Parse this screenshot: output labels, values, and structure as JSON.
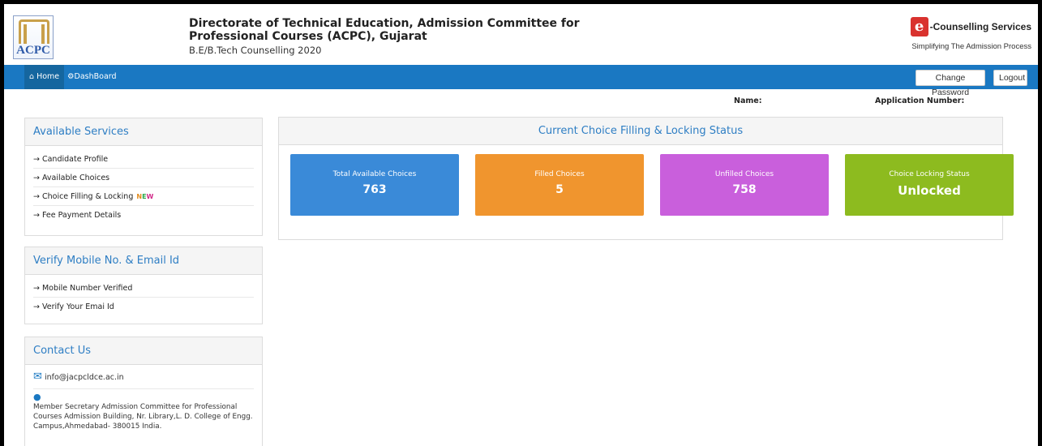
{
  "header": {
    "logo_text": "ACPC",
    "title_line1": "Directorate of Technical Education, Admission Committee for",
    "title_line2": "Professional Courses (ACPC), Gujarat",
    "subtitle": "B.E/B.Tech Counselling 2020",
    "ec_mark": "e",
    "ec_name": "-Counselling Services",
    "ec_tagline": "Simplifying The Admission Process"
  },
  "nav": {
    "home_icon": "home-icon",
    "home": "Home",
    "dashboard_icon": "dashboard-icon",
    "dashboard": "DashBoard",
    "change_password": "Change Password",
    "logout": "Logout"
  },
  "info": {
    "name_label": "Name:",
    "application_label": "Application Number:"
  },
  "available_services": {
    "title": "Available Services",
    "items": [
      "→ Candidate Profile",
      "→ Available Choices",
      "→ Choice Filling & Locking",
      "→ Fee Payment Details"
    ],
    "new_badge": [
      "N",
      "E",
      "W"
    ]
  },
  "verify": {
    "title": "Verify Mobile No. & Email Id",
    "items": [
      "→ Mobile Number Verified",
      "→ Verify Your Emai Id"
    ]
  },
  "contact": {
    "title": "Contact Us",
    "email": "info@jacpcldce.ac.in",
    "address": "Member Secretary Admission Committee for Professional Courses Admission Building, Nr. Library,L. D. College of Engg. Campus,Ahmedabad- 380015 India."
  },
  "status": {
    "title": "Current Choice Filling & Locking Status",
    "cards": [
      {
        "label": "Total Available Choices",
        "value": "763",
        "color": "#3a8ad8"
      },
      {
        "label": "Filled Choices",
        "value": "5",
        "color": "#f0952e"
      },
      {
        "label": "Unfilled Choices",
        "value": "758",
        "color": "#c95fdc"
      },
      {
        "label": "Choice Locking Status",
        "value": "Unlocked",
        "color": "#8dbb1f"
      }
    ]
  },
  "colors": {
    "navbar": "#1a78c2",
    "panel_heading": "#2e7ec4"
  }
}
